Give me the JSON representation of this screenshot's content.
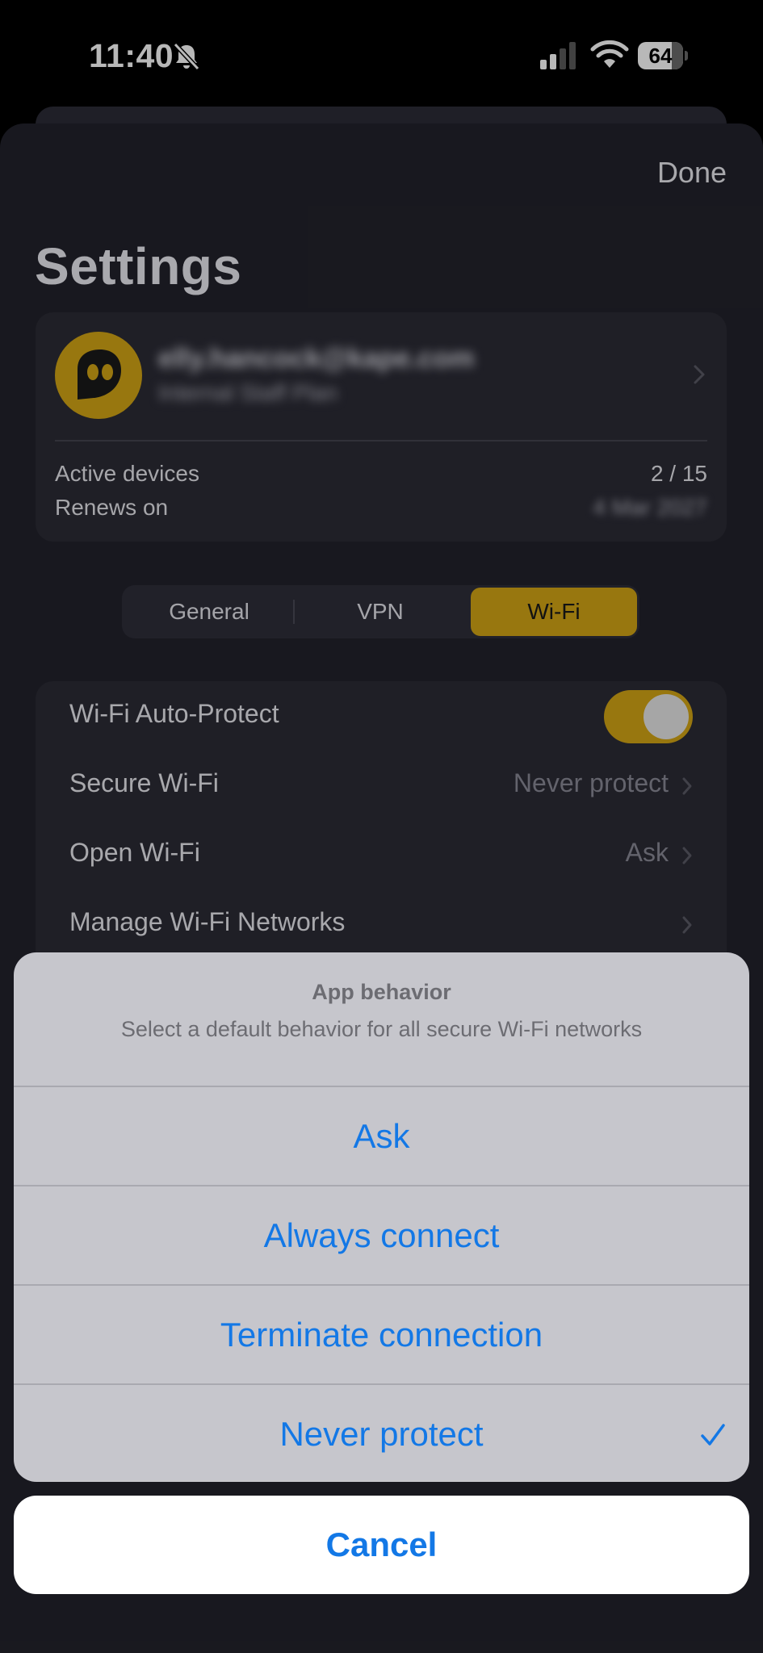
{
  "status_bar": {
    "time": "11:40",
    "battery": "64",
    "icons": [
      "bell-slash-icon",
      "cellular-signal-icon",
      "wifi-icon",
      "battery-icon"
    ]
  },
  "header": {
    "done_label": "Done",
    "title": "Settings"
  },
  "account": {
    "email": "elly.hancock@kape.com",
    "plan": "Internal Staff Plan",
    "active_devices_label": "Active devices",
    "active_devices_value": "2 / 15",
    "renews_label": "Renews on",
    "renews_value": "4 Mar 2027"
  },
  "tabs": [
    {
      "label": "General",
      "active": false
    },
    {
      "label": "VPN",
      "active": false
    },
    {
      "label": "Wi-Fi",
      "active": true
    }
  ],
  "wifi_settings": {
    "auto_protect_label": "Wi-Fi Auto-Protect",
    "auto_protect_on": true,
    "secure_wifi_label": "Secure Wi-Fi",
    "secure_wifi_value": "Never protect",
    "open_wifi_label": "Open Wi-Fi",
    "open_wifi_value": "Ask",
    "manage_label": "Manage Wi-Fi Networks"
  },
  "action_sheet": {
    "title": "App behavior",
    "subtitle": "Select a default behavior for all secure Wi-Fi networks",
    "options": [
      {
        "label": "Ask",
        "selected": false
      },
      {
        "label": "Always connect",
        "selected": false
      },
      {
        "label": "Terminate connection",
        "selected": false
      },
      {
        "label": "Never protect",
        "selected": true
      }
    ],
    "cancel_label": "Cancel"
  },
  "colors": {
    "accent": "#d3a515",
    "ios_blue": "#1378e6",
    "sheet_bg": "#22222b",
    "card_bg": "#2b2b35"
  }
}
